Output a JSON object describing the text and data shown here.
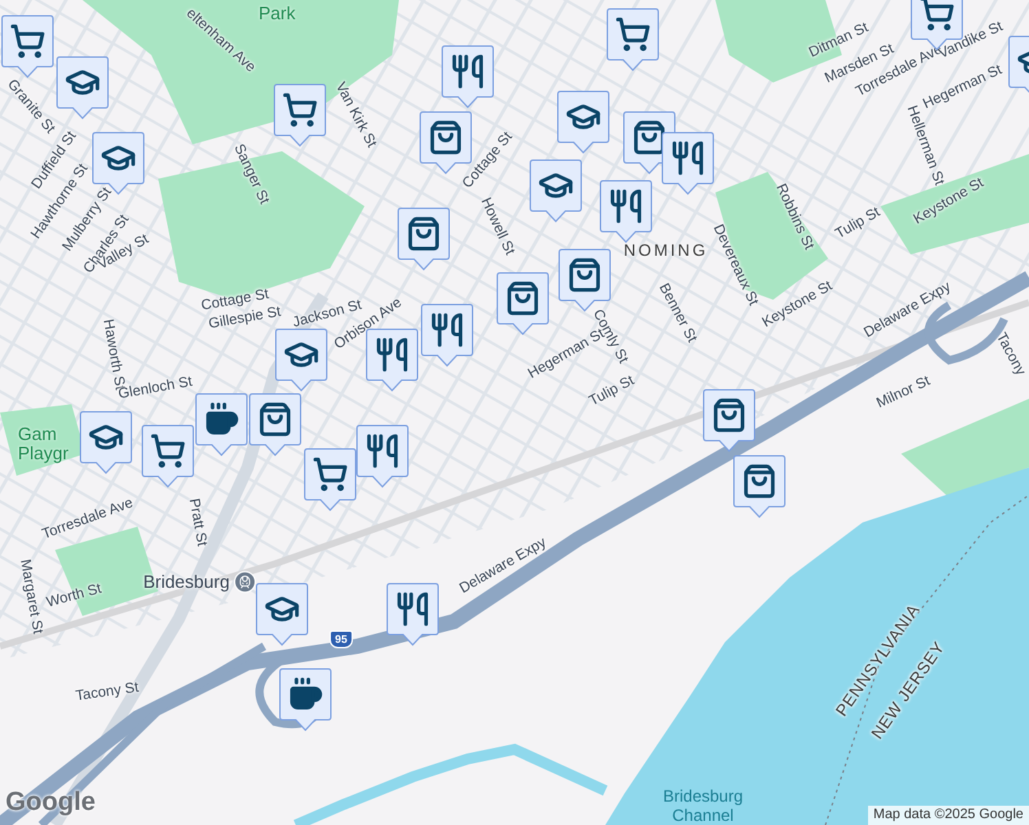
{
  "map": {
    "labels": [
      {
        "text": "Park",
        "kind": "park"
      },
      {
        "text": "eltenham Ave",
        "kind": "street"
      },
      {
        "text": "Sanger St",
        "kind": "street"
      },
      {
        "text": "Van Kirk St",
        "kind": "street"
      },
      {
        "text": "Granite St",
        "kind": "street"
      },
      {
        "text": "Duffield St",
        "kind": "street"
      },
      {
        "text": "Hawthorne St",
        "kind": "street"
      },
      {
        "text": "Mulberry St",
        "kind": "street"
      },
      {
        "text": "Charles St",
        "kind": "street"
      },
      {
        "text": "Valley St",
        "kind": "street"
      },
      {
        "text": "Haworth St",
        "kind": "street"
      },
      {
        "text": "Cottage St",
        "kind": "street"
      },
      {
        "text": "Gillespie St",
        "kind": "street"
      },
      {
        "text": "Glenloch St",
        "kind": "street"
      },
      {
        "text": "Cottage St",
        "kind": "street"
      },
      {
        "text": "Howell St",
        "kind": "street"
      },
      {
        "text": "Comly St",
        "kind": "street"
      },
      {
        "text": "Hegerman St",
        "kind": "street"
      },
      {
        "text": "Tulip St",
        "kind": "street"
      },
      {
        "text": "Benner St",
        "kind": "street"
      },
      {
        "text": "Devereaux St",
        "kind": "street"
      },
      {
        "text": "Robbins St",
        "kind": "street"
      },
      {
        "text": "Tulip St",
        "kind": "street"
      },
      {
        "text": "Keystone St",
        "kind": "street"
      },
      {
        "text": "Keystone St",
        "kind": "street"
      },
      {
        "text": "Delaware Expy",
        "kind": "street"
      },
      {
        "text": "Tacony",
        "kind": "street"
      },
      {
        "text": "Milnor St",
        "kind": "street"
      },
      {
        "text": "Ditman St",
        "kind": "street"
      },
      {
        "text": "Marsden St",
        "kind": "street"
      },
      {
        "text": "Torresdale Ave",
        "kind": "street"
      },
      {
        "text": "Hellerman St",
        "kind": "street"
      },
      {
        "text": "Hegerman St",
        "kind": "street"
      },
      {
        "text": "Vandike St",
        "kind": "street"
      },
      {
        "text": "NOMING",
        "kind": "area"
      },
      {
        "text": "Torresdale Ave",
        "kind": "street"
      },
      {
        "text": "Pratt St",
        "kind": "street"
      },
      {
        "text": "Margaret St",
        "kind": "street"
      },
      {
        "text": "Worth St",
        "kind": "street"
      },
      {
        "text": "Bridesburg",
        "kind": "station"
      },
      {
        "text": "Tacony St",
        "kind": "street"
      },
      {
        "text": "Delaware Expy",
        "kind": "street"
      },
      {
        "text": "PENNSYLVANIA",
        "kind": "state"
      },
      {
        "text": "NEW JERSEY",
        "kind": "state"
      },
      {
        "text": "Bridesburg Channel",
        "kind": "water"
      },
      {
        "text": "Jackson St",
        "kind": "street"
      },
      {
        "text": "Orbison Ave",
        "kind": "street"
      },
      {
        "text": "Gam Playgr",
        "kind": "park"
      },
      {
        "text": "95",
        "kind": "shield"
      }
    ],
    "pins": [
      {
        "kind": "grocery"
      },
      {
        "kind": "school"
      },
      {
        "kind": "school"
      },
      {
        "kind": "grocery"
      },
      {
        "kind": "restaurant"
      },
      {
        "kind": "shopping"
      },
      {
        "kind": "shopping"
      },
      {
        "kind": "grocery"
      },
      {
        "kind": "school"
      },
      {
        "kind": "shopping"
      },
      {
        "kind": "restaurant"
      },
      {
        "kind": "school"
      },
      {
        "kind": "restaurant"
      },
      {
        "kind": "shopping"
      },
      {
        "kind": "shopping"
      },
      {
        "kind": "school"
      },
      {
        "kind": "restaurant"
      },
      {
        "kind": "restaurant"
      },
      {
        "kind": "school"
      },
      {
        "kind": "shopping"
      },
      {
        "kind": "cafe"
      },
      {
        "kind": "school"
      },
      {
        "kind": "grocery"
      },
      {
        "kind": "restaurant"
      },
      {
        "kind": "grocery"
      },
      {
        "kind": "grocery"
      },
      {
        "kind": "school"
      },
      {
        "kind": "restaurant"
      },
      {
        "kind": "cafe"
      },
      {
        "kind": "shopping"
      },
      {
        "kind": "shopping"
      }
    ],
    "attribution": "Map data ©2025 Google",
    "logo": "Google"
  }
}
